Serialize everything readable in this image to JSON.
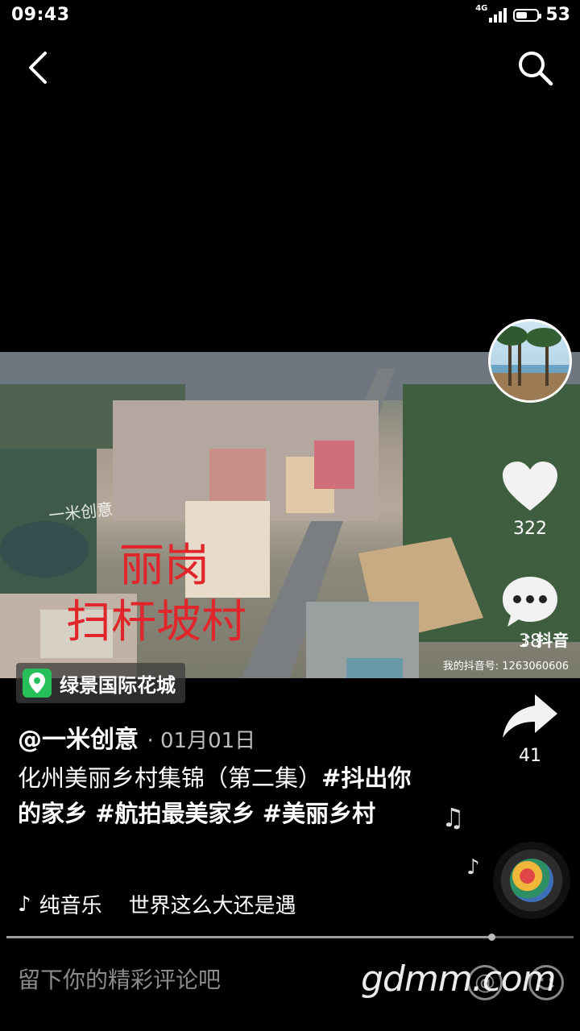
{
  "status_bar": {
    "time": "09:43",
    "network": "4G",
    "battery": "53",
    "battery_level": 0.53
  },
  "icons": {
    "back": "back-icon",
    "search": "search-icon",
    "like": "heart-icon",
    "comment": "comment-icon",
    "share": "share-icon",
    "location": "location-pin-icon",
    "music": "douyin-note-icon",
    "at": "at-icon",
    "emoji": "emoji-icon"
  },
  "video": {
    "caption_line1": "丽岗",
    "caption_line2": "扫杆坡村",
    "watermark": "一米创意",
    "douyin_brand": "抖音",
    "douyin_id": "我的抖音号: 1263060606"
  },
  "location": {
    "label": "绿景国际花城"
  },
  "actions": {
    "likes": "322",
    "comments": "38",
    "shares": "41"
  },
  "post": {
    "author": "@一米创意",
    "date": "· 01月01日",
    "desc_text": "化州美丽乡村集锦（第二集）",
    "tags": [
      "#抖出你的家乡",
      "#航拍最美家乡",
      "#美丽乡村"
    ]
  },
  "music": {
    "text": "纯音乐    世界这么大还是遇"
  },
  "progress": {
    "fraction": 0.855
  },
  "comment_box": {
    "placeholder": "留下你的精彩评论吧"
  },
  "watermark_site": "gdmm.com",
  "colors": {
    "caption_red": "#e0252b",
    "location_green": "#26c05a"
  }
}
